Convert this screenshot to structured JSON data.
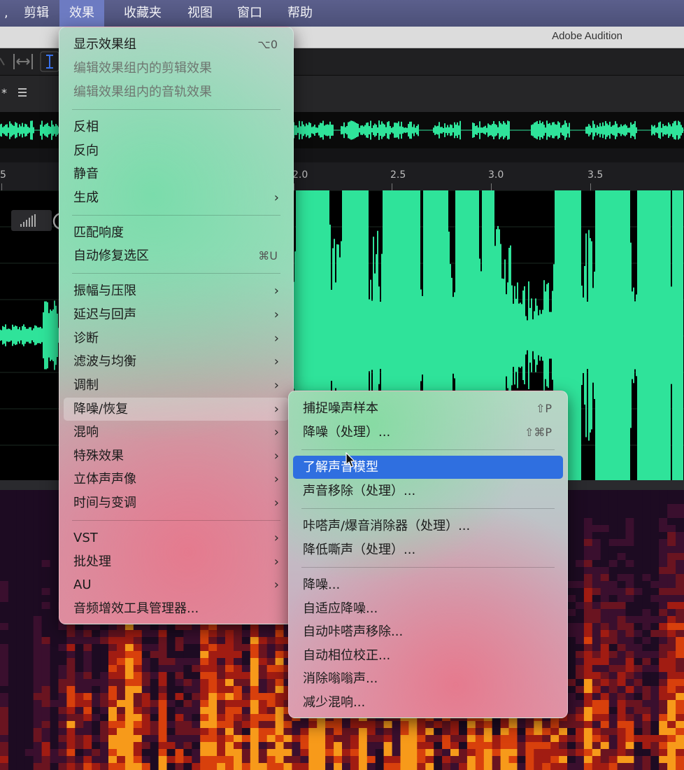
{
  "menubar": {
    "items": [
      {
        "label": "剪辑",
        "active": false
      },
      {
        "label": "效果",
        "active": true
      },
      {
        "label": "收藏夹",
        "active": false
      },
      {
        "label": "视图",
        "active": false
      },
      {
        "label": "窗口",
        "active": false
      },
      {
        "label": "帮助",
        "active": false
      }
    ]
  },
  "window": {
    "title": "Adobe Audition"
  },
  "ruler": {
    "ticks": [
      "5",
      "2.0",
      "2.5",
      "3.0",
      "3.5"
    ]
  },
  "effects_menu": {
    "items": [
      {
        "label": "显示效果组",
        "shortcut": "⌥0"
      },
      {
        "label": "编辑效果组内的剪辑效果",
        "disabled": true
      },
      {
        "label": "编辑效果组内的音轨效果",
        "disabled": true
      },
      {
        "label": "反相"
      },
      {
        "label": "反向"
      },
      {
        "label": "静音"
      },
      {
        "label": "生成",
        "submenu": true
      },
      {
        "label": "匹配响度"
      },
      {
        "label": "自动修复选区",
        "shortcut": "⌘U"
      },
      {
        "label": "振幅与压限",
        "submenu": true
      },
      {
        "label": "延迟与回声",
        "submenu": true
      },
      {
        "label": "诊断",
        "submenu": true
      },
      {
        "label": "滤波与均衡",
        "submenu": true
      },
      {
        "label": "调制",
        "submenu": true
      },
      {
        "label": "降噪/恢复",
        "submenu": true,
        "open": true
      },
      {
        "label": "混响",
        "submenu": true
      },
      {
        "label": "特殊效果",
        "submenu": true
      },
      {
        "label": "立体声声像",
        "submenu": true
      },
      {
        "label": "时间与变调",
        "submenu": true
      },
      {
        "label": "VST",
        "submenu": true
      },
      {
        "label": "批处理",
        "submenu": true
      },
      {
        "label": "AU",
        "submenu": true
      },
      {
        "label": "音频增效工具管理器..."
      }
    ]
  },
  "noise_submenu": {
    "items": [
      {
        "label": "捕捉噪声样本",
        "shortcut": "⇧P"
      },
      {
        "label": "降噪（处理）...",
        "shortcut": "⇧⌘P"
      },
      {
        "label": "了解声音模型",
        "selected": true
      },
      {
        "label": "声音移除（处理）..."
      },
      {
        "label": "咔嗒声/爆音消除器（处理）..."
      },
      {
        "label": "降低嘶声（处理）..."
      },
      {
        "label": "降噪..."
      },
      {
        "label": "自适应降噪..."
      },
      {
        "label": "自动咔嗒声移除..."
      },
      {
        "label": "自动相位校正..."
      },
      {
        "label": "消除嗡嗡声..."
      },
      {
        "label": "减少混响..."
      }
    ]
  },
  "colors": {
    "waveform": "#2fe39a",
    "menubar": "#4c5078",
    "selection": "#2f6fe0"
  },
  "icons": {
    "cursor": "arrow-cursor-icon",
    "submenu": "chevron-right-icon"
  }
}
